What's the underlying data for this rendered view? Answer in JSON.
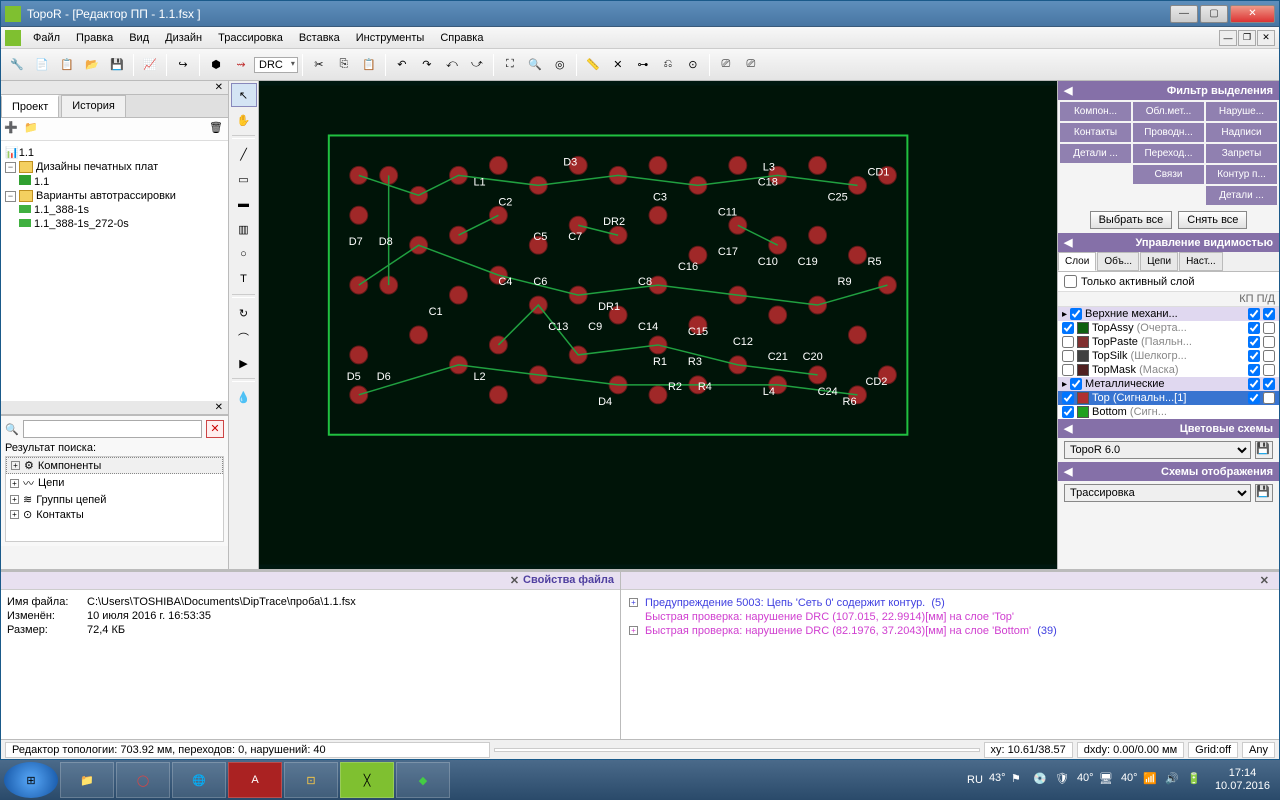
{
  "window": {
    "title": "TopoR - [Редактор ПП - 1.1.fsx ]"
  },
  "menu": [
    "Файл",
    "Правка",
    "Вид",
    "Дизайн",
    "Трассировка",
    "Вставка",
    "Инструменты",
    "Справка"
  ],
  "drc_label": "DRC",
  "project": {
    "tab_project": "Проект",
    "tab_history": "История",
    "root": "1.1",
    "folder_designs": "Дизайны печатных плат",
    "design_item": "1.1",
    "folder_variants": "Варианты автотрассировки",
    "variant1": "1.1_388-1s",
    "variant2": "1.1_388-1s_272-0s"
  },
  "search": {
    "label": "Результат поиска:",
    "items": [
      "Компоненты",
      "Цепи",
      "Группы цепей",
      "Контакты"
    ]
  },
  "filter": {
    "title": "Фильтр выделения",
    "buttons": [
      "Компон...",
      "Обл.мет...",
      "Наруше...",
      "Контакты",
      "Проводн...",
      "Надписи",
      "Детали ...",
      "Переход...",
      "Запреты",
      "",
      "Связи",
      "Контур п...",
      "",
      "",
      "Детали ..."
    ],
    "select_all": "Выбрать все",
    "deselect_all": "Снять все"
  },
  "visibility": {
    "title": "Управление видимостью",
    "tabs": [
      "Слои",
      "Объ...",
      "Цепи",
      "Наст..."
    ],
    "only_active": "Только активный слой",
    "col_hdr": "КП П/Д",
    "groups": {
      "mech": "Верхние механи...",
      "metal": "Металлические"
    },
    "layers": [
      {
        "name": "TopAssy",
        "note": "(Очерта...",
        "color": "#106010"
      },
      {
        "name": "TopPaste",
        "note": "(Паяльн...",
        "color": "#803030"
      },
      {
        "name": "TopSilk",
        "note": "(Шелкогр...",
        "color": "#404040"
      },
      {
        "name": "TopMask",
        "note": "(Маска)",
        "color": "#502020"
      },
      {
        "name": "Top",
        "note": "(Сигнальн...[1]",
        "color": "#b03030",
        "sel": true
      },
      {
        "name": "Bottom",
        "note": "(Сигн...",
        "color": "#20a020"
      }
    ]
  },
  "color_scheme": {
    "title": "Цветовые схемы",
    "value": "TopoR 6.0"
  },
  "display_scheme": {
    "title": "Схемы отображения",
    "value": "Трассировка"
  },
  "properties": {
    "title": "Свойства файла",
    "rows": {
      "file_lbl": "Имя файла:",
      "file_val": "C:\\Users\\TOSHIBA\\Documents\\DipTrace\\проба\\1.1.fsx",
      "mod_lbl": "Изменён:",
      "mod_val": "10 июля 2016 г. 16:53:35",
      "size_lbl": "Размер:",
      "size_val": "72,4 КБ"
    }
  },
  "messages": [
    {
      "cls": "blue",
      "text": "Предупреждение 5003: Цепь 'Сеть 0' содержит контур.",
      "cnt": "(5)",
      "exp": true
    },
    {
      "cls": "pink",
      "text": "Быстрая проверка: нарушение DRC (107.015, 22.9914)[мм] на слое 'Top'"
    },
    {
      "cls": "pink",
      "text": "Быстрая проверка: нарушение DRC (82.1976, 37.2043)[мм] на слое 'Bottom'",
      "cnt": "(39)",
      "exp": true
    }
  ],
  "status": {
    "main": "Редактор топологии: 703.92 мм, переходов: 0, нарушений: 40",
    "xy": "xy: 10.61/38.57",
    "dxdy": "dxdy: 0.00/0.00 мм",
    "grid": "Grid:off",
    "any": "Any"
  },
  "taskbar": {
    "lang": "RU",
    "time": "17:14",
    "date": "10.07.2016"
  }
}
